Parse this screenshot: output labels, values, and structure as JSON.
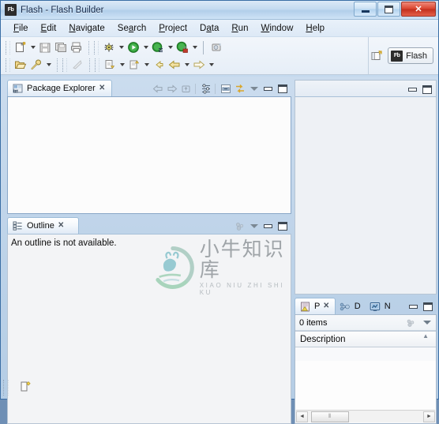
{
  "window": {
    "title": "Flash - Flash Builder",
    "app_icon": "Fb",
    "controls": {
      "minimize": "minimize-button",
      "restore": "restore-button",
      "close": "✕"
    }
  },
  "menubar": {
    "items": [
      {
        "label": "File",
        "mnemonic": "F"
      },
      {
        "label": "Edit",
        "mnemonic": "E"
      },
      {
        "label": "Navigate",
        "mnemonic": "N"
      },
      {
        "label": "Search",
        "mnemonic": "a"
      },
      {
        "label": "Project",
        "mnemonic": "P"
      },
      {
        "label": "Data",
        "mnemonic": "a"
      },
      {
        "label": "Run",
        "mnemonic": "R"
      },
      {
        "label": "Window",
        "mnemonic": "W"
      },
      {
        "label": "Help",
        "mnemonic": "H"
      }
    ]
  },
  "toolbar": {
    "row1": [
      {
        "name": "new-button",
        "icon": "new-file-icon"
      },
      {
        "name": "new-dropdown",
        "icon": "chevron-down-icon"
      },
      {
        "name": "save-button",
        "icon": "save-icon"
      },
      {
        "name": "save-all-button",
        "icon": "save-all-icon"
      },
      {
        "name": "print-button",
        "icon": "print-icon"
      },
      {
        "name": "debug-button",
        "icon": "debug-bug-icon"
      },
      {
        "name": "debug-dropdown",
        "icon": "chevron-down-icon"
      },
      {
        "name": "run-button",
        "icon": "run-play-icon"
      },
      {
        "name": "run-dropdown",
        "icon": "chevron-down-icon"
      },
      {
        "name": "profile-button",
        "icon": "profile-icon"
      },
      {
        "name": "profile-dropdown",
        "icon": "chevron-down-icon"
      },
      {
        "name": "secure-run-button",
        "icon": "run-lock-icon"
      },
      {
        "name": "secure-run-dropdown",
        "icon": "chevron-down-icon"
      },
      {
        "name": "external-tools-button",
        "icon": "external-tools-icon"
      }
    ],
    "row2": [
      {
        "name": "open-button",
        "icon": "open-folder-icon"
      },
      {
        "name": "search-button",
        "icon": "search-pin-icon"
      },
      {
        "name": "search-dropdown",
        "icon": "chevron-down-icon"
      },
      {
        "name": "publish-button",
        "icon": "publish-icon"
      },
      {
        "name": "next-annotation-button",
        "icon": "next-annotation-icon"
      },
      {
        "name": "next-annotation-dropdown",
        "icon": "chevron-down-icon"
      },
      {
        "name": "prev-annotation-button",
        "icon": "prev-annotation-icon"
      },
      {
        "name": "prev-annotation-dropdown",
        "icon": "chevron-down-icon"
      },
      {
        "name": "last-edit-button",
        "icon": "last-edit-location-icon"
      },
      {
        "name": "back-button",
        "icon": "back-arrow-icon"
      },
      {
        "name": "back-dropdown",
        "icon": "chevron-down-icon"
      },
      {
        "name": "forward-button",
        "icon": "forward-arrow-icon"
      },
      {
        "name": "forward-dropdown",
        "icon": "chevron-down-icon"
      }
    ],
    "perspective": {
      "open_perspective_icon": "open-perspective-icon",
      "active_label": "Flash",
      "active_icon": "Fb"
    }
  },
  "package_explorer": {
    "tab_label": "Package Explorer",
    "tab_icon": "package-explorer-icon",
    "close": "✕",
    "tools": [
      {
        "name": "back-button",
        "icon": "back-arrow-icon"
      },
      {
        "name": "forward-button",
        "icon": "forward-arrow-icon"
      },
      {
        "name": "up-button",
        "icon": "up-level-icon"
      },
      {
        "name": "filters-button",
        "icon": "filter-icon"
      },
      {
        "name": "collapse-all-button",
        "icon": "collapse-all-icon"
      },
      {
        "name": "link-with-editor-button",
        "icon": "link-editor-icon"
      },
      {
        "name": "view-menu-button",
        "icon": "chevron-down-icon"
      },
      {
        "name": "minimize-button",
        "icon": "minimize-icon"
      },
      {
        "name": "maximize-button",
        "icon": "maximize-icon"
      }
    ],
    "tree_items": []
  },
  "outline": {
    "tab_label": "Outline",
    "tab_icon": "outline-icon",
    "close": "✕",
    "message": "An outline is not available.",
    "tools": [
      {
        "name": "view-options-button",
        "icon": "outline-options-icon"
      },
      {
        "name": "view-menu-button",
        "icon": "chevron-down-icon"
      },
      {
        "name": "minimize-button",
        "icon": "minimize-icon"
      },
      {
        "name": "maximize-button",
        "icon": "maximize-icon"
      }
    ]
  },
  "editor_area": {
    "tools": [
      {
        "name": "minimize-button",
        "icon": "minimize-icon"
      },
      {
        "name": "maximize-button",
        "icon": "maximize-icon"
      }
    ]
  },
  "problems_panel": {
    "tabs": [
      {
        "label": "P",
        "icon": "problems-icon",
        "active": true,
        "close": "✕"
      },
      {
        "label": "D",
        "icon": "data-services-icon",
        "active": false
      },
      {
        "label": "N",
        "icon": "network-monitor-icon",
        "active": false
      }
    ],
    "tools": [
      {
        "name": "minimize-button",
        "icon": "minimize-icon"
      },
      {
        "name": "maximize-button",
        "icon": "maximize-icon"
      }
    ],
    "item_count_label": "0 items",
    "item_tools": [
      {
        "name": "filters-button",
        "icon": "problems-filter-icon"
      },
      {
        "name": "view-menu-button",
        "icon": "chevron-down-icon"
      }
    ],
    "columns": [
      "Description"
    ],
    "rows": [],
    "hscroll": {
      "left": "◄",
      "right": "►",
      "thumb": "⦀"
    }
  },
  "statusbar": {
    "icon": "smart-insert-icon",
    "text": ""
  },
  "watermark": {
    "cn": "小牛知识库",
    "en": "XIAO NIU ZHI SHI KU",
    "logo": "niu-circle-logo",
    "color": "#a0a5a9"
  },
  "colors": {
    "accent": "#3a6ea5",
    "close_red": "#c22f1c",
    "run_green": "#2d9b34",
    "panel_bg": "#f3f4f6",
    "content_bg": "#fcfcfc"
  }
}
